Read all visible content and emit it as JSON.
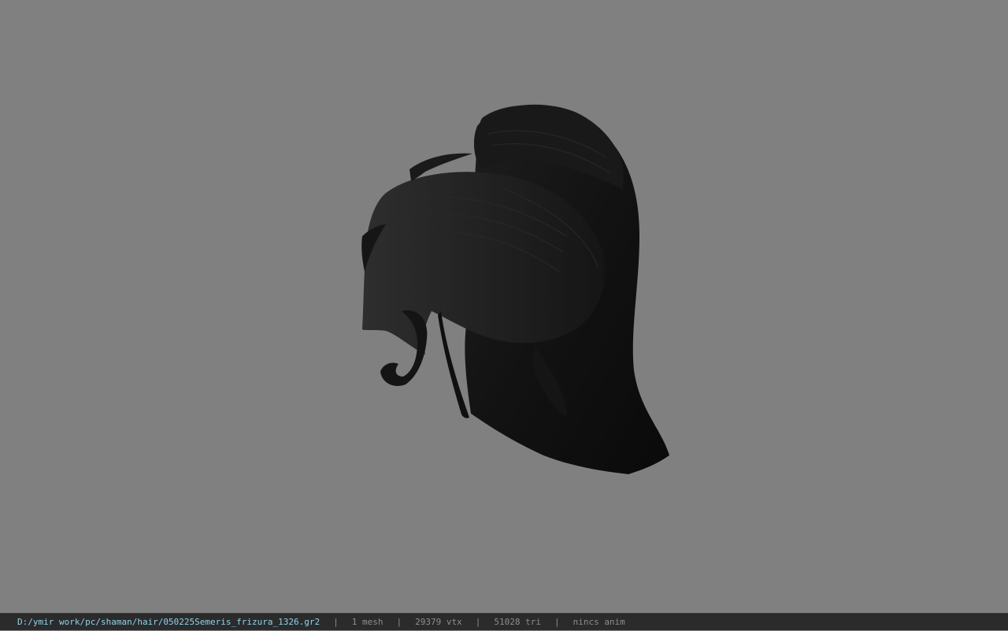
{
  "viewport": {
    "background_color": "#808080",
    "model_icon": "hair-mesh"
  },
  "statusbar": {
    "file_path": "D:/ymir work/pc/shaman/hair/050225Semeris_frizura_1326.gr2",
    "separator": "|",
    "mesh_count": "1 mesh",
    "vertex_count": "29379 vtx",
    "triangle_count": "51028 tri",
    "anim_status": "nincs anim",
    "path_color": "#8fd3ec",
    "text_color": "#8e8e8e",
    "background_color": "#2b2b2b"
  }
}
